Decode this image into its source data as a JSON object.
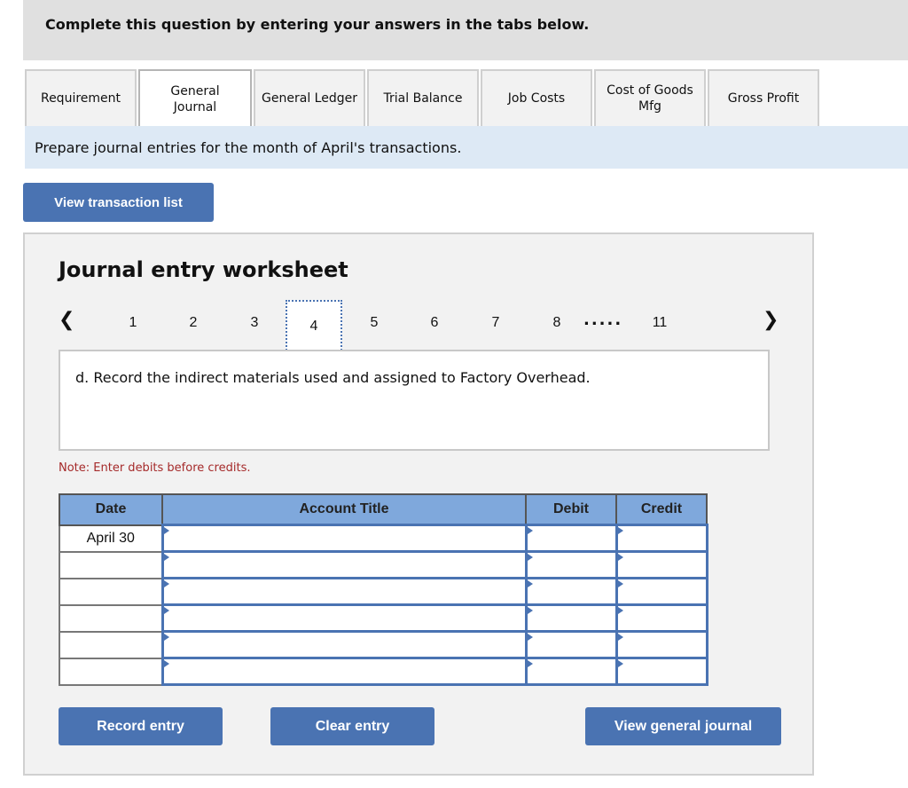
{
  "header": {
    "title": "Complete this question by entering your answers in the tabs below."
  },
  "tabs": [
    {
      "label": "Requirement",
      "active": false
    },
    {
      "label": "General\nJournal",
      "active": true
    },
    {
      "label": "General Ledger",
      "active": false
    },
    {
      "label": "Trial Balance",
      "active": false
    },
    {
      "label": "Job Costs",
      "active": false
    },
    {
      "label": "Cost of Goods\nMfg",
      "active": false
    },
    {
      "label": "Gross Profit",
      "active": false
    }
  ],
  "instruction": "Prepare journal entries for the month of April's transactions.",
  "view_transaction_list_label": "View transaction list",
  "worksheet": {
    "title": "Journal entry worksheet",
    "pager": {
      "prev_icon": "chevron-left-icon",
      "next_icon": "chevron-right-icon",
      "pages": [
        "1",
        "2",
        "3",
        "4",
        "5",
        "6",
        "7",
        "8"
      ],
      "ellipsis": ".....",
      "last_page": "11",
      "current": "4"
    },
    "description": "d. Record the indirect materials used and assigned to Factory Overhead.",
    "note": "Note: Enter debits before credits.",
    "table": {
      "headers": [
        "Date",
        "Account Title",
        "Debit",
        "Credit"
      ],
      "rows": [
        {
          "date": "April 30",
          "account": "",
          "debit": "",
          "credit": ""
        },
        {
          "date": "",
          "account": "",
          "debit": "",
          "credit": ""
        },
        {
          "date": "",
          "account": "",
          "debit": "",
          "credit": ""
        },
        {
          "date": "",
          "account": "",
          "debit": "",
          "credit": ""
        },
        {
          "date": "",
          "account": "",
          "debit": "",
          "credit": ""
        },
        {
          "date": "",
          "account": "",
          "debit": "",
          "credit": ""
        }
      ]
    },
    "buttons": {
      "record": "Record entry",
      "clear": "Clear entry",
      "view_journal": "View general journal"
    }
  },
  "colors": {
    "button": "#4a73b2",
    "header_fill": "#7fa8dc",
    "note": "#a52a2a",
    "instruction_bg": "#dde9f5"
  }
}
